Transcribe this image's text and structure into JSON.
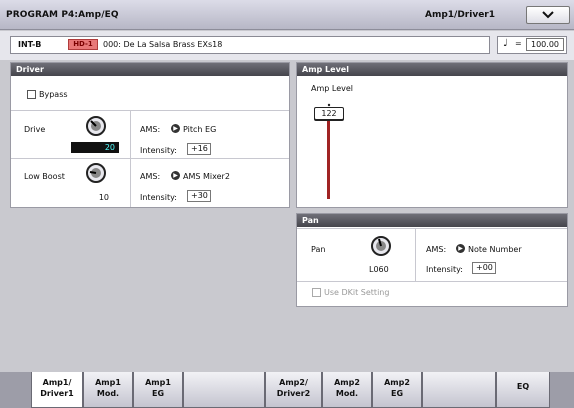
{
  "header": {
    "title": "PROGRAM P4:Amp/EQ",
    "page_name": "Amp1/Driver1",
    "menu_icon": "chevron-down-icon"
  },
  "program": {
    "bank": "INT-B",
    "badge": "HD-1",
    "name": "000: De La Salsa Brass EXs18",
    "tempo_symbol": "♩",
    "tempo_eq": "=",
    "tempo": "100.00"
  },
  "driver": {
    "title": "Driver",
    "bypass_label": "Bypass",
    "drive": {
      "label": "Drive",
      "value": "20",
      "ams_label": "AMS:",
      "ams_source": "Pitch EG",
      "intensity_label": "Intensity:",
      "intensity": "+16"
    },
    "low_boost": {
      "label": "Low Boost",
      "value": "10",
      "ams_label": "AMS:",
      "ams_source": "AMS Mixer2",
      "intensity_label": "Intensity:",
      "intensity": "+30"
    }
  },
  "amp_level": {
    "title": "Amp Level",
    "label": "Amp Level",
    "value": "122",
    "max": 127
  },
  "pan": {
    "title": "Pan",
    "label": "Pan",
    "value": "L060",
    "ams_label": "AMS:",
    "ams_source": "Note Number",
    "intensity_label": "Intensity:",
    "intensity": "+00",
    "dkit_label": "Use DKit Setting"
  },
  "tabs": [
    {
      "line1": "Amp1/",
      "line2": "Driver1"
    },
    {
      "line1": "Amp1",
      "line2": "Mod."
    },
    {
      "line1": "Amp1",
      "line2": "EG"
    },
    {
      "line1": "Amp2/",
      "line2": "Driver2"
    },
    {
      "line1": "Amp2",
      "line2": "Mod."
    },
    {
      "line1": "Amp2",
      "line2": "EG"
    },
    {
      "line1": "EQ",
      "line2": ""
    }
  ]
}
